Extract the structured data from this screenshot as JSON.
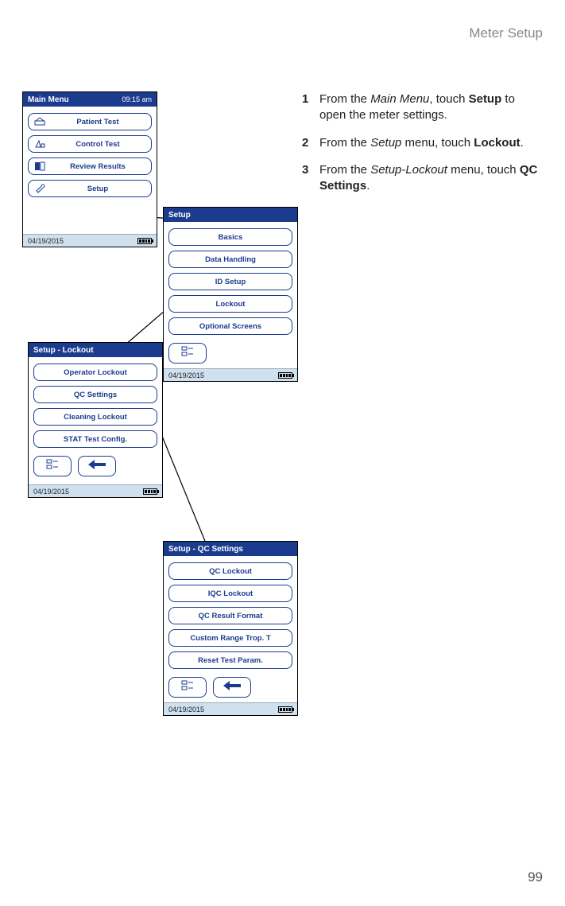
{
  "breadcrumb": "Meter Setup",
  "page_number": "99",
  "steps": [
    {
      "num": "1",
      "pre": "From the ",
      "em1": "Main Menu",
      "mid": ", touch ",
      "strong": "Setup",
      "post": " to open the meter settings."
    },
    {
      "num": "2",
      "pre": "From the ",
      "em1": "Setup",
      "mid": " menu, touch ",
      "strong": "Lockout",
      "post": "."
    },
    {
      "num": "3",
      "pre": "From the ",
      "em1": "Setup-Lockout",
      "mid": " menu, touch ",
      "strong": "QC Settings",
      "post": "."
    }
  ],
  "screens": {
    "main": {
      "title": "Main Menu",
      "time": "09:15 am",
      "date": "04/19/2015",
      "items": [
        {
          "id": "patient-test",
          "label": "Patient Test",
          "icon": "patient"
        },
        {
          "id": "control-test",
          "label": "Control Test",
          "icon": "control"
        },
        {
          "id": "review-results",
          "label": "Review Results",
          "icon": "review"
        },
        {
          "id": "setup",
          "label": "Setup",
          "icon": "wrench"
        }
      ]
    },
    "setup": {
      "title": "Setup",
      "date": "04/19/2015",
      "items": [
        {
          "id": "basics",
          "label": "Basics"
        },
        {
          "id": "data-handling",
          "label": "Data Handling"
        },
        {
          "id": "id-setup",
          "label": "ID Setup"
        },
        {
          "id": "lockout",
          "label": "Lockout"
        },
        {
          "id": "optional-screens",
          "label": "Optional Screens"
        }
      ]
    },
    "lockout": {
      "title": "Setup - Lockout",
      "date": "04/19/2015",
      "items": [
        {
          "id": "operator-lockout",
          "label": "Operator Lockout"
        },
        {
          "id": "qc-settings",
          "label": "QC Settings"
        },
        {
          "id": "cleaning-lockout",
          "label": "Cleaning Lockout"
        },
        {
          "id": "stat-test-config",
          "label": "STAT Test Config."
        }
      ]
    },
    "qc": {
      "title": "Setup - QC Settings",
      "date": "04/19/2015",
      "items": [
        {
          "id": "qc-lockout",
          "label": "QC Lockout"
        },
        {
          "id": "iqc-lockout",
          "label": "IQC Lockout"
        },
        {
          "id": "qc-result-format",
          "label": "QC Result Format"
        },
        {
          "id": "custom-range-tropt",
          "label": "Custom Range Trop. T"
        },
        {
          "id": "reset-test-param",
          "label": "Reset Test Param."
        }
      ]
    }
  }
}
